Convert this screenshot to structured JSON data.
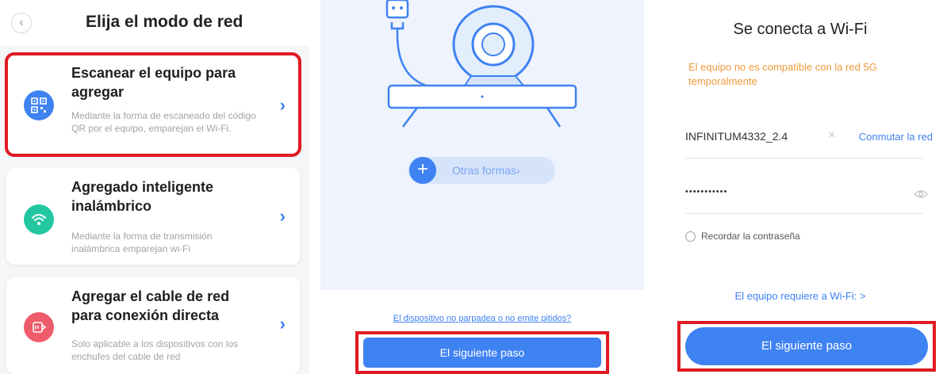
{
  "panel1": {
    "back_icon": "chevron-left-icon",
    "title": "Elija el modo de red",
    "cards": [
      {
        "title": "Escanear el equipo para agregar",
        "description": "Mediante la forma de escaneado del código QR por el equipo, emparejan el Wi-Fi.",
        "icon": "qr-code-icon",
        "icon_color": "#3f82f2",
        "selected": true
      },
      {
        "title": "Agregado inteligente inalámbrico",
        "description": "Mediante la forma de transmisión inalámbrica emparejan wi-Fi",
        "icon": "wifi-icon",
        "icon_color": "#22c7a1",
        "selected": false
      },
      {
        "title": "Agregar el cable de red para conexión directa",
        "description": "Solo aplicable a los dispositivos con los enchufes del cable de red",
        "icon": "ethernet-plug-icon",
        "icon_color": "#ee5b6a",
        "selected": false
      }
    ],
    "chevron": "›"
  },
  "panel2": {
    "illustration": "camera-plug-illustration",
    "other_ways_label": "Otras formas›",
    "help_link": "El dispositivo no parpadea o no emite pitidos?",
    "next_button": "El siguiente paso"
  },
  "panel3": {
    "title": "Se conecta a Wi-Fi",
    "warning": "El equipo no es compatible con la red 5G temporalmente",
    "ssid": "INFINITUM4332_2.4",
    "clear_icon": "×",
    "switch_network": "Conmutar la red",
    "password_masked": "•••••••••••",
    "remember_password": "Recordar la contraseña",
    "requirement_link": "El equipo requiere a Wi-Fi: >",
    "next_button": "El siguiente paso"
  },
  "colors": {
    "accent": "#3f82f2",
    "highlight_border": "#e01a22",
    "warning": "#f09a3c"
  }
}
